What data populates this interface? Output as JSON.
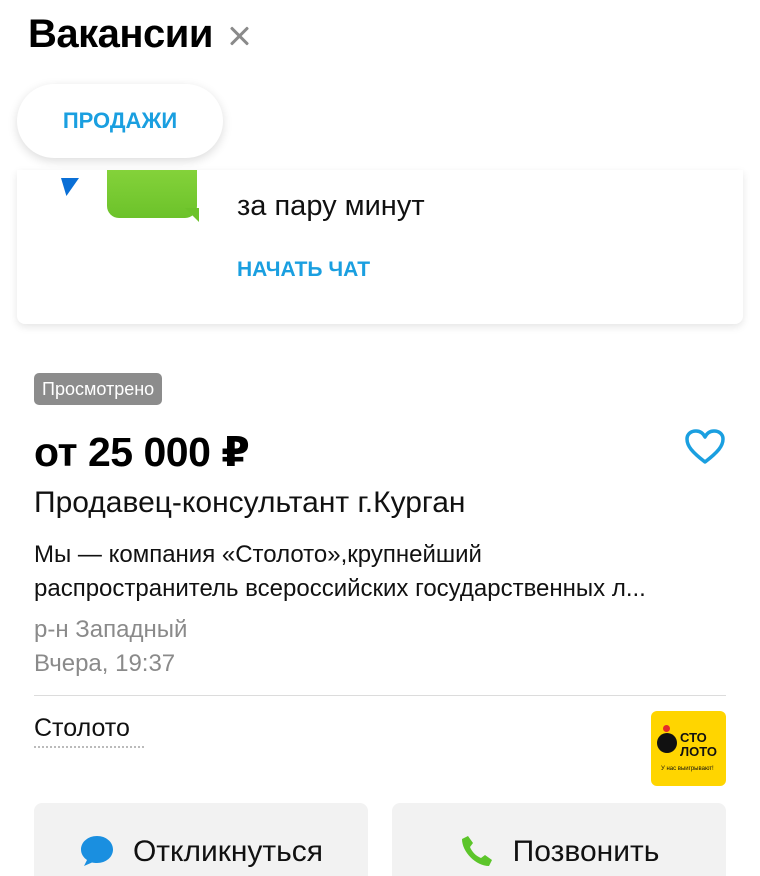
{
  "header": {
    "title": "Вакансии"
  },
  "filter": {
    "label": "ПРОДАЖИ"
  },
  "chat_card": {
    "text": "за пару минут",
    "link": "НАЧАТЬ ЧАТ"
  },
  "listing": {
    "badge": "Просмотрено",
    "salary": "от 25 000 ₽",
    "title": "Продавец-консультант г.Курган",
    "description": [
      "Мы — компания «Столото»,крупнейший",
      "распространитель всероссийских государственных л..."
    ],
    "district": "р-н Западный",
    "date": "Вчера, 19:37",
    "company": "Столото",
    "logo": {
      "line1": "СТО",
      "line2": "ЛОТО",
      "tagline": "У нас выигрывают!"
    }
  },
  "actions": {
    "respond_label": "Откликнуться",
    "call_label": "Позвонить"
  },
  "colors": {
    "accent": "#1a9fe0",
    "badge_bg": "#8c8c8c",
    "muted_text": "#8a8a8a",
    "call_icon": "#5cc52a",
    "respond_icon": "#1a8fe0",
    "logo_bg": "#ffd500"
  },
  "icons": {
    "close": "close-icon",
    "favorite": "heart-outline-icon",
    "respond": "chat-bubble-icon",
    "call": "phone-icon"
  }
}
